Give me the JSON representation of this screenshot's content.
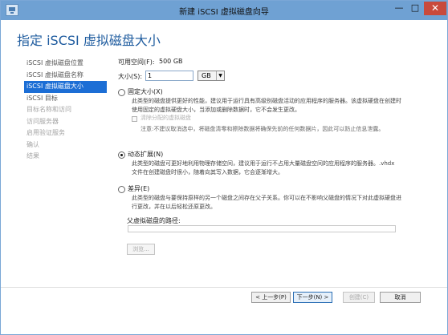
{
  "window": {
    "title": "新建 iSCSI 虚拟磁盘向导",
    "minimize": "—",
    "maximize": "□",
    "close": "✕"
  },
  "page": {
    "title": "指定 iSCSI 虚拟磁盘大小"
  },
  "sidebar": {
    "items": [
      {
        "label": "iSCSI 虚拟磁盘位置",
        "state": "normal"
      },
      {
        "label": "iSCSI 虚拟磁盘名称",
        "state": "normal"
      },
      {
        "label": "iSCSI 虚拟磁盘大小",
        "state": "active"
      },
      {
        "label": "iSCSI 目标",
        "state": "normal"
      },
      {
        "label": "目标名称和访问",
        "state": "disabled"
      },
      {
        "label": "访问服务器",
        "state": "disabled"
      },
      {
        "label": "启用验证服务",
        "state": "disabled"
      },
      {
        "label": "确认",
        "state": "disabled"
      },
      {
        "label": "结果",
        "state": "disabled"
      }
    ]
  },
  "form": {
    "free_space_label": "可用空间(F):",
    "free_space_value": "500 GB",
    "size_label": "大小(S):",
    "size_value": "1",
    "unit_value": "GB",
    "unit_arrow": "▼",
    "fixed_label": "固定大小(X)",
    "fixed_desc": "此类型的磁盘提供更好的性能，建议用于运行具有高级别磁盘活动的应用程序的服务器。该虚拟硬盘在创建时使用固定的虚拟硬盘大小，当添加或删除数据时，它不会发生更改。",
    "erase_label": "清除分配的虚拟磁盘",
    "erase_desc": "注意:不建议取消选中，将磁盘清零和擦除数据将确保先前的任何数据片，因此可以防止信息泄露。",
    "dynamic_label": "动态扩展(N)",
    "dynamic_desc": "此类型的磁盘可更好地利用物理存储空间，建议用于运行不占用大量磁盘空间的应用程序的服务器。.vhdx 文件在创建磁盘时很小，随着向其写入数据，它会逐渐增大。",
    "difference_label": "差异(E)",
    "difference_desc": "此类型的磁盘与要保持原样的另一个磁盘之间存在父子关系。你可以在不影响父磁盘的情况下对此虚拟硬盘进行更改，并在以后轻松还原更改。",
    "parent_path_label": "父虚拟磁盘的路径:",
    "browse_label": "浏览..."
  },
  "footer": {
    "previous_label": "< 上一步(P)",
    "next_label": "下一步(N) >",
    "create_label": "创建(C)",
    "cancel_label": "取消"
  },
  "colors": {
    "titlebar": "#6fa1d3",
    "accent": "#1c6ed5",
    "title": "#1f5c9f",
    "close": "#c94a3c"
  }
}
